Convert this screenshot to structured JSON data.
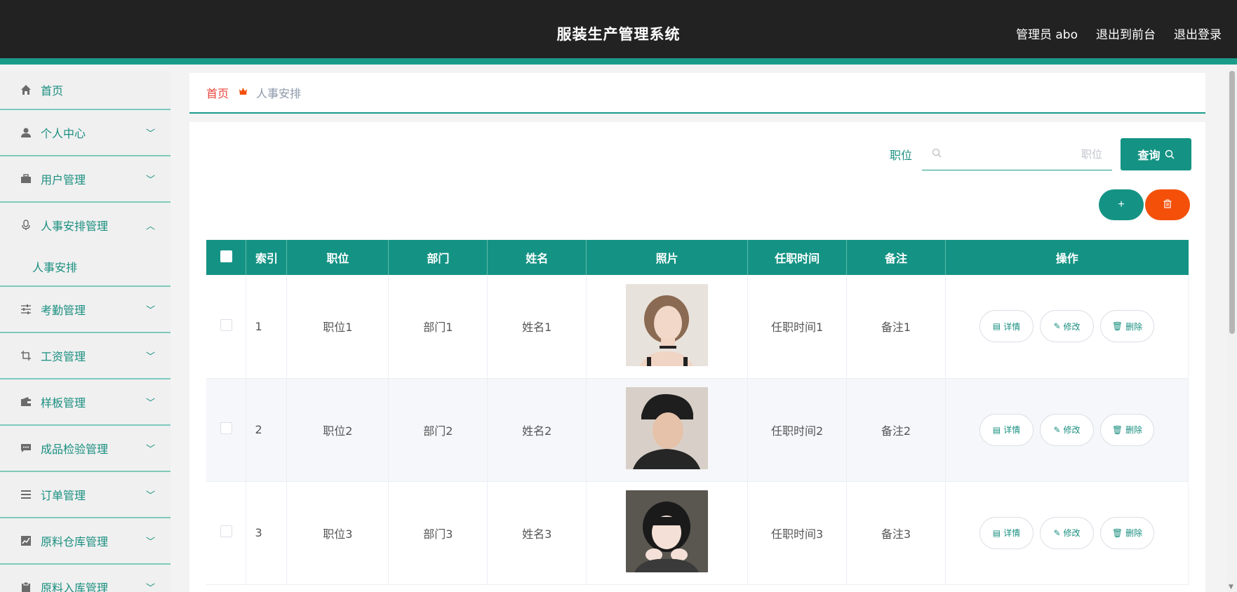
{
  "header": {
    "title": "服装生产管理系统",
    "user": "管理员 abo",
    "to_front": "退出到前台",
    "logout": "退出登录"
  },
  "sidebar": {
    "items": [
      {
        "label": "首页",
        "icon": "home-icon"
      },
      {
        "label": "个人中心",
        "icon": "user-icon"
      },
      {
        "label": "用户管理",
        "icon": "briefcase-icon"
      },
      {
        "label": "人事安排管理",
        "icon": "microphone-icon"
      },
      {
        "label": "人事安排",
        "icon": ""
      },
      {
        "label": "考勤管理",
        "icon": "sliders-icon"
      },
      {
        "label": "工资管理",
        "icon": "crop-icon"
      },
      {
        "label": "样板管理",
        "icon": "wallet-icon"
      },
      {
        "label": "成品检验管理",
        "icon": "message-icon"
      },
      {
        "label": "订单管理",
        "icon": "list-icon"
      },
      {
        "label": "原料仓库管理",
        "icon": "chart-icon"
      },
      {
        "label": "原料入库管理",
        "icon": "clipboard-icon"
      }
    ]
  },
  "breadcrumb": {
    "home": "首页",
    "current": "人事安排"
  },
  "search": {
    "label": "职位",
    "placeholder": "职位",
    "button": "查询"
  },
  "actions": {
    "add": "+",
    "delete": "🗑"
  },
  "table": {
    "headers": [
      "索引",
      "职位",
      "部门",
      "姓名",
      "照片",
      "任职时间",
      "备注",
      "操作"
    ],
    "rows": [
      {
        "index": "1",
        "position": "职位1",
        "dept": "部门1",
        "name": "姓名1",
        "time": "任职时间1",
        "note": "备注1"
      },
      {
        "index": "2",
        "position": "职位2",
        "dept": "部门2",
        "name": "姓名2",
        "time": "任职时间2",
        "note": "备注2"
      },
      {
        "index": "3",
        "position": "职位3",
        "dept": "部门3",
        "name": "姓名3",
        "time": "任职时间3",
        "note": "备注3"
      }
    ],
    "ops": {
      "detail": "详情",
      "edit": "修改",
      "delete": "删除"
    }
  },
  "colors": {
    "accent": "#149384",
    "danger": "#f4500a",
    "header_bg": "#222222"
  }
}
